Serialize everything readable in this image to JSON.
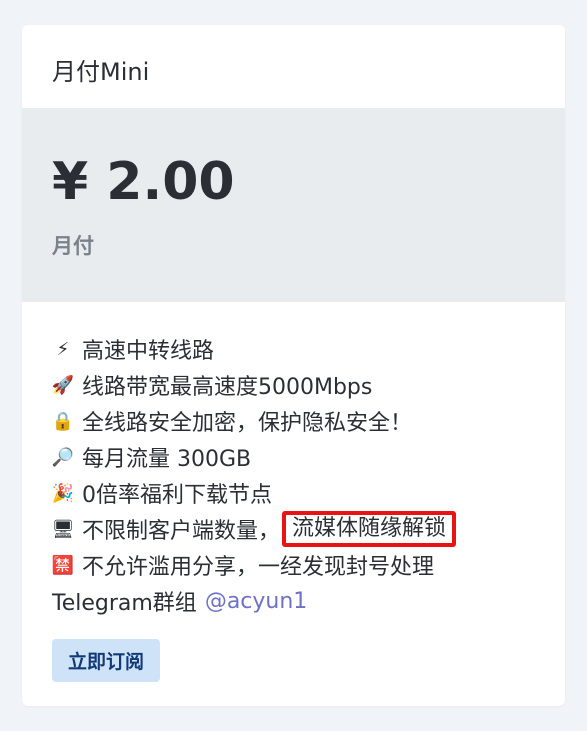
{
  "plan": {
    "name": "月付Mini",
    "price": "¥ 2.00",
    "period": "月付"
  },
  "features": [
    {
      "icon": "lightning-icon",
      "glyph": "⚡",
      "text": "高速中转线路"
    },
    {
      "icon": "rocket-icon",
      "glyph": "🚀",
      "text": "线路带宽最高速度5000Mbps"
    },
    {
      "icon": "lock-icon",
      "glyph": "🔒",
      "text": "全线路安全加密，保护隐私安全！"
    },
    {
      "icon": "magnifier-icon",
      "glyph": "🔎",
      "text": "每月流量 300GB"
    },
    {
      "icon": "party-popper-icon",
      "glyph": "🎉",
      "text": "0倍率福利下载节点"
    },
    {
      "icon": "desktop-icon",
      "glyph": "🖥",
      "text": "不限制客户端数量，",
      "highlight": "流媒体随缘解锁"
    },
    {
      "icon": "prohibited-icon",
      "glyph": "🈲",
      "text": "不允许滥用分享，一经发现封号处理"
    }
  ],
  "telegram": {
    "label": "Telegram群组",
    "handle": "@acyun1"
  },
  "subscribe_label": "立即订阅",
  "colors": {
    "highlight_border": "#e81313",
    "link": "#6f71c6",
    "button_bg": "#cfe3f8",
    "button_text": "#123a78"
  }
}
